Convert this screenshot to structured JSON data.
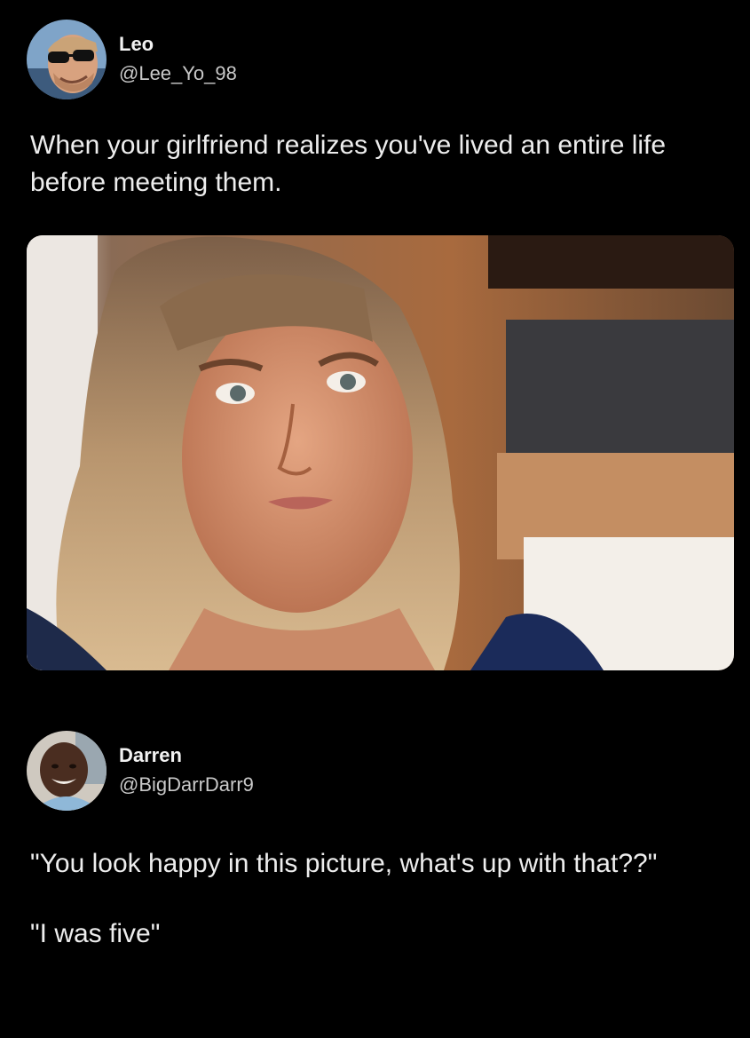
{
  "tweets": [
    {
      "author": {
        "name": "Leo",
        "handle": "@Lee_Yo_98",
        "avatar_icon": "avatar-sunglasses-man"
      },
      "text": "When your girlfriend realizes you've lived an entire life before meeting them.",
      "media": {
        "type": "photo"
      }
    },
    {
      "author": {
        "name": "Darren",
        "handle": "@BigDarrDarr9",
        "avatar_icon": "avatar-smiling-man"
      },
      "paragraphs": [
        "\"You look happy in this picture, what's up with that??\"",
        "\"I was five\""
      ]
    }
  ],
  "colors": {
    "background": "#000000",
    "text": "#ededed",
    "handle": "#c9c9c9"
  }
}
